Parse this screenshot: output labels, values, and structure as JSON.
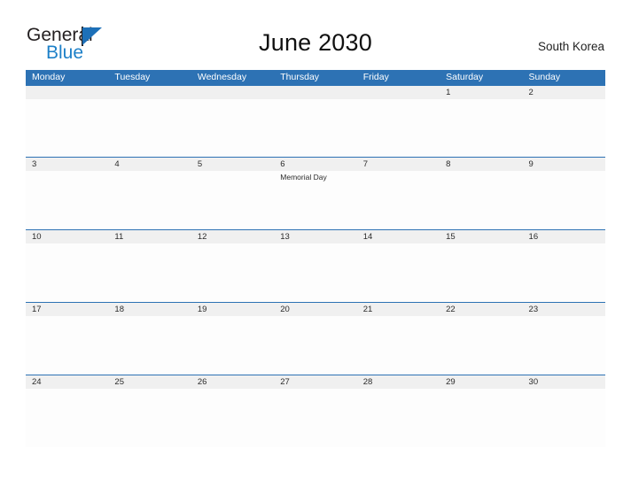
{
  "brand": {
    "name_top": "General",
    "name_bottom": "Blue",
    "color_dark": "#231f20",
    "color_blue": "#1d80c8"
  },
  "header": {
    "title": "June 2030",
    "region": "South Korea"
  },
  "theme": {
    "header_blue": "#2d72b4",
    "date_band": "#f0f0f0",
    "cell_bg": "#fdfdfd",
    "text": "#2b2b2b"
  },
  "weekdays": [
    "Monday",
    "Tuesday",
    "Wednesday",
    "Thursday",
    "Friday",
    "Saturday",
    "Sunday"
  ],
  "weeks": [
    {
      "days": [
        {
          "num": "",
          "event": ""
        },
        {
          "num": "",
          "event": ""
        },
        {
          "num": "",
          "event": ""
        },
        {
          "num": "",
          "event": ""
        },
        {
          "num": "",
          "event": ""
        },
        {
          "num": "1",
          "event": ""
        },
        {
          "num": "2",
          "event": ""
        }
      ]
    },
    {
      "days": [
        {
          "num": "3",
          "event": ""
        },
        {
          "num": "4",
          "event": ""
        },
        {
          "num": "5",
          "event": ""
        },
        {
          "num": "6",
          "event": "Memorial Day"
        },
        {
          "num": "7",
          "event": ""
        },
        {
          "num": "8",
          "event": ""
        },
        {
          "num": "9",
          "event": ""
        }
      ]
    },
    {
      "days": [
        {
          "num": "10",
          "event": ""
        },
        {
          "num": "11",
          "event": ""
        },
        {
          "num": "12",
          "event": ""
        },
        {
          "num": "13",
          "event": ""
        },
        {
          "num": "14",
          "event": ""
        },
        {
          "num": "15",
          "event": ""
        },
        {
          "num": "16",
          "event": ""
        }
      ]
    },
    {
      "days": [
        {
          "num": "17",
          "event": ""
        },
        {
          "num": "18",
          "event": ""
        },
        {
          "num": "19",
          "event": ""
        },
        {
          "num": "20",
          "event": ""
        },
        {
          "num": "21",
          "event": ""
        },
        {
          "num": "22",
          "event": ""
        },
        {
          "num": "23",
          "event": ""
        }
      ]
    },
    {
      "days": [
        {
          "num": "24",
          "event": ""
        },
        {
          "num": "25",
          "event": ""
        },
        {
          "num": "26",
          "event": ""
        },
        {
          "num": "27",
          "event": ""
        },
        {
          "num": "28",
          "event": ""
        },
        {
          "num": "29",
          "event": ""
        },
        {
          "num": "30",
          "event": ""
        }
      ]
    }
  ]
}
